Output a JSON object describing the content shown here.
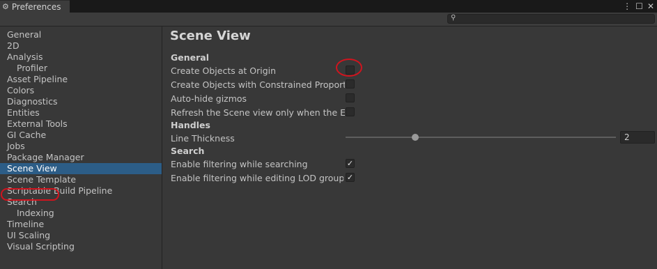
{
  "window": {
    "tab_title": "Preferences",
    "controls": {
      "menu_icon": "⋮",
      "maximize_icon": "☐",
      "close_icon": "✕"
    }
  },
  "search": {
    "placeholder": ""
  },
  "sidebar": {
    "items": [
      {
        "label": "General"
      },
      {
        "label": "2D"
      },
      {
        "label": "Analysis"
      },
      {
        "label": "Profiler"
      },
      {
        "label": "Asset Pipeline"
      },
      {
        "label": "Colors"
      },
      {
        "label": "Diagnostics"
      },
      {
        "label": "Entities"
      },
      {
        "label": "External Tools"
      },
      {
        "label": "GI Cache"
      },
      {
        "label": "Jobs"
      },
      {
        "label": "Package Manager"
      },
      {
        "label": "Scene View"
      },
      {
        "label": "Scene Template"
      },
      {
        "label": "Scriptable Build Pipeline"
      },
      {
        "label": "Search"
      },
      {
        "label": "Indexing"
      },
      {
        "label": "Timeline"
      },
      {
        "label": "UI Scaling"
      },
      {
        "label": "Visual Scripting"
      }
    ],
    "selected": "Scene View"
  },
  "main": {
    "title": "Scene View",
    "general": {
      "heading": "General",
      "create_at_origin": {
        "label": "Create Objects at Origin",
        "checked": false
      },
      "constrained_proportions": {
        "label": "Create Objects with Constrained Proportions",
        "checked": false
      },
      "auto_hide_gizmos": {
        "label": "Auto-hide gizmos",
        "checked": false
      },
      "refresh_scene_view": {
        "label": "Refresh the Scene view only when the Editor",
        "checked": false
      }
    },
    "handles": {
      "heading": "Handles",
      "line_thickness": {
        "label": "Line Thickness",
        "value": "2"
      }
    },
    "search": {
      "heading": "Search",
      "filter_searching": {
        "label": "Enable filtering while searching",
        "checked": true
      },
      "filter_lod": {
        "label": "Enable filtering while editing LOD groups",
        "checked": true
      }
    }
  }
}
